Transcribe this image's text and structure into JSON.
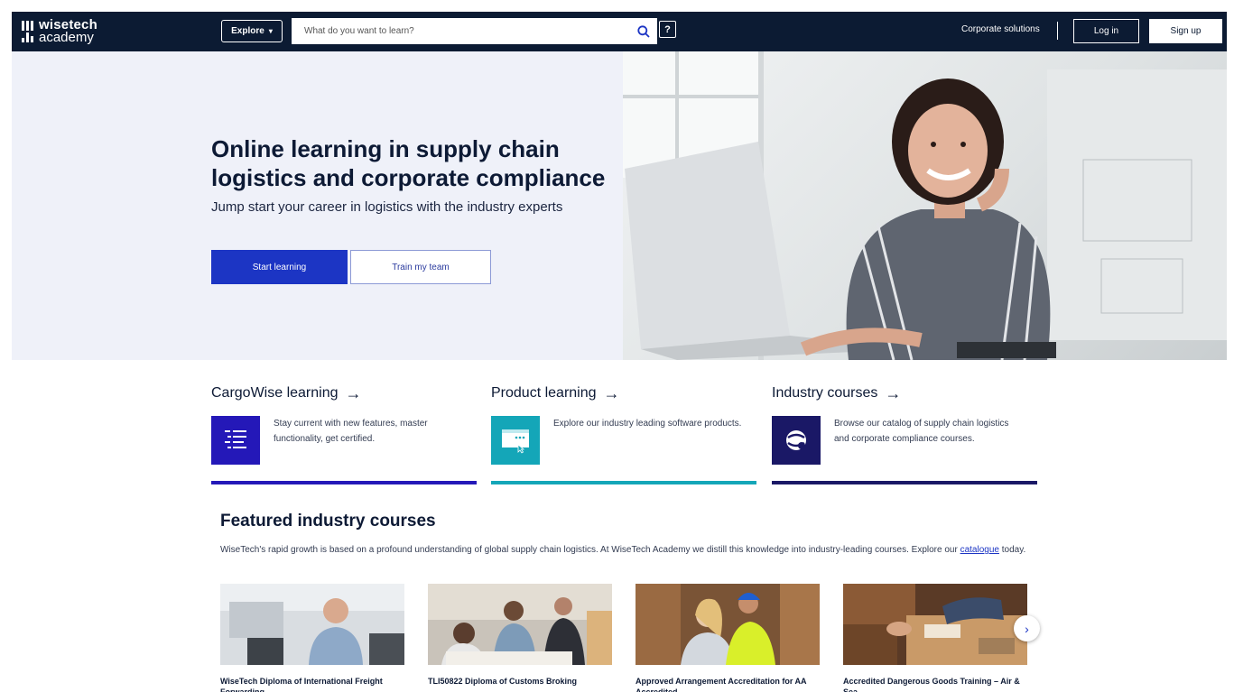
{
  "brand": {
    "line1": "wisetech",
    "line2": "academy"
  },
  "nav": {
    "explore_label": "Explore",
    "search_placeholder": "What do you want to learn?",
    "help_label": "?",
    "corporate_label": "Corporate solutions",
    "login_label": "Log in",
    "signup_label": "Sign up"
  },
  "hero": {
    "title": "Online learning in supply chain logistics and corporate compliance",
    "subtitle": "Jump start your career in logistics with the industry experts",
    "primary_cta": "Start learning",
    "secondary_cta": "Train my team"
  },
  "categories": [
    {
      "title": "CargoWise learning",
      "arrow": "→",
      "description": "Stay current with new features, master functionality, get certified.",
      "icon": "list-icon",
      "color": "#2418b8"
    },
    {
      "title": "Product learning",
      "arrow": "→",
      "description": "Explore our industry leading software products.",
      "icon": "screen-icon",
      "color": "#14a6b8"
    },
    {
      "title": "Industry courses",
      "arrow": "→",
      "description": "Browse our catalog of supply chain logistics and corporate compliance courses.",
      "icon": "globe-icon",
      "color": "#1a1866"
    }
  ],
  "featured": {
    "title": "Featured industry courses",
    "description_before": "WiseTech's rapid growth is based on a profound understanding of global supply chain logistics. At WiseTech Academy we distill this knowledge into industry-leading courses. Explore our ",
    "link_text": "catalogue",
    "description_after": " today.",
    "courses": [
      {
        "title": "WiseTech Diploma of International Freight Forwarding"
      },
      {
        "title": "TLI50822 Diploma of Customs Broking"
      },
      {
        "title": "Approved Arrangement Accreditation for AA Accredited"
      },
      {
        "title": "Accredited Dangerous Goods Training – Air & Sea"
      }
    ],
    "next_label": "›"
  },
  "colors": {
    "nav_bg": "#0c1b33",
    "primary": "#1c35c4",
    "hero_bg": "#eff1f9"
  }
}
